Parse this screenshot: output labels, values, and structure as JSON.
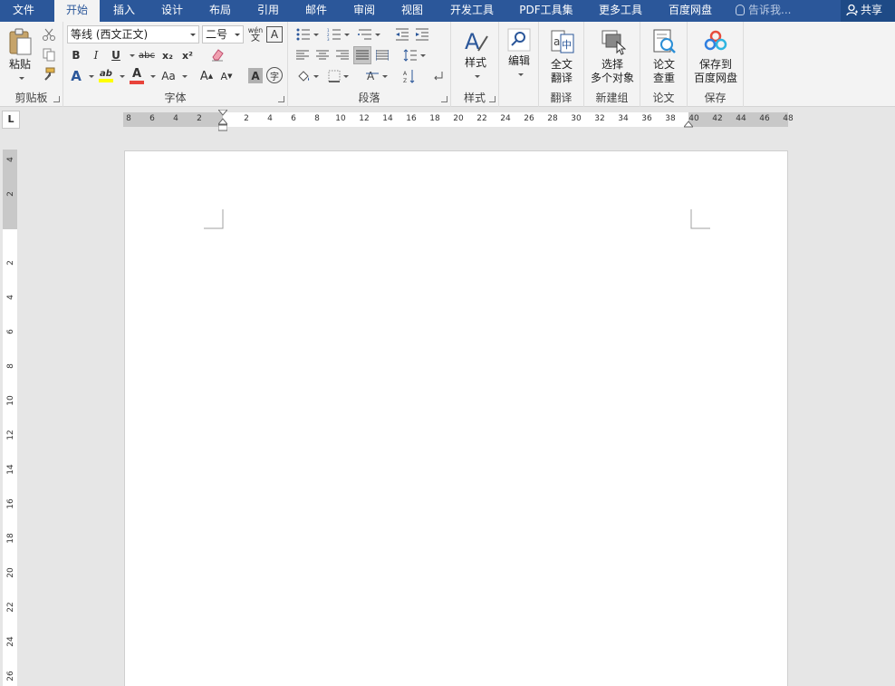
{
  "tabs": [
    "文件",
    "开始",
    "插入",
    "设计",
    "布局",
    "引用",
    "邮件",
    "审阅",
    "视图",
    "开发工具",
    "PDF工具集",
    "更多工具",
    "百度网盘"
  ],
  "active_tab": "开始",
  "tell_me": "告诉我...",
  "share": "共享",
  "clipboard": {
    "paste": "粘贴",
    "label": "剪贴板"
  },
  "font": {
    "family": "等线 (西文正文)",
    "size": "二号",
    "label": "字体",
    "pinyin": "wén",
    "pinyin_char": "文",
    "border_char": "A",
    "bold": "B",
    "italic": "I",
    "underline": "U",
    "strike": "abc",
    "sub": "x₂",
    "sup": "x²",
    "effects": "A",
    "highlight": "ab",
    "color": "A",
    "case": "Aa",
    "grow": "A",
    "shrink": "A",
    "shading": "A",
    "enclose": "字"
  },
  "paragraph": {
    "label": "段落"
  },
  "styles": {
    "btn": "样式",
    "label": "样式"
  },
  "editing": {
    "btn": "编辑"
  },
  "translate": {
    "line1": "全文",
    "line2": "翻译",
    "label": "翻译"
  },
  "newgroup": {
    "line1": "选择",
    "line2": "多个对象",
    "label": "新建组"
  },
  "paper": {
    "line1": "论文",
    "line2": "查重",
    "label": "论文"
  },
  "save": {
    "line1": "保存到",
    "line2": "百度网盘",
    "label": "保存"
  },
  "ruler": {
    "tab_selector": "L",
    "h_labels": [
      "8",
      "6",
      "4",
      "2",
      "2",
      "4",
      "6",
      "8",
      "10",
      "12",
      "14",
      "16",
      "18",
      "20",
      "22",
      "24",
      "26",
      "28",
      "30",
      "32",
      "34",
      "36",
      "38",
      "40",
      "42",
      "44",
      "46",
      "48"
    ],
    "v_labels": [
      "4",
      "2",
      "2",
      "4",
      "6",
      "8",
      "10",
      "12",
      "14",
      "16",
      "18",
      "20",
      "22",
      "24",
      "26"
    ]
  },
  "colors": {
    "accent": "#2b579a",
    "highlight": "#ffff00",
    "font_color": "#e8433a",
    "baidu_blue": "#2f7fe0",
    "baidu_red": "#e74c3c"
  }
}
